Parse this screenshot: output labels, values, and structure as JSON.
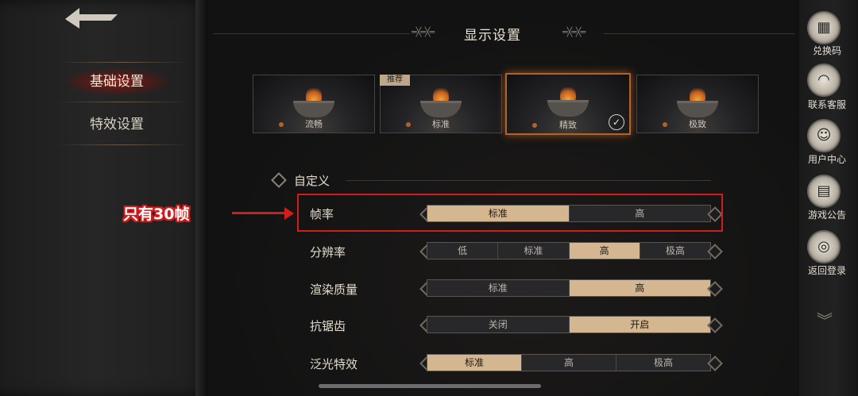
{
  "nav": {
    "items": [
      {
        "label": "基础设置",
        "active": true
      },
      {
        "label": "特效设置",
        "active": false
      }
    ]
  },
  "header": {
    "title": "显示设置"
  },
  "quality_presets": [
    {
      "label": "流畅",
      "selected": false
    },
    {
      "label": "标准",
      "selected": false,
      "badge": "推荐"
    },
    {
      "label": "精致",
      "selected": true
    },
    {
      "label": "极致",
      "selected": false
    }
  ],
  "custom": {
    "label": "自定义"
  },
  "settings": [
    {
      "label": "帧率",
      "options": [
        "标准",
        "高"
      ],
      "selected": 0
    },
    {
      "label": "分辨率",
      "options": [
        "低",
        "标准",
        "高",
        "极高"
      ],
      "selected": 2
    },
    {
      "label": "渲染质量",
      "options": [
        "标准",
        "高"
      ],
      "selected": 1
    },
    {
      "label": "抗锯齿",
      "options": [
        "关闭",
        "开启"
      ],
      "selected": 1
    },
    {
      "label": "泛光特效",
      "options": [
        "标准",
        "高",
        "极高"
      ],
      "selected": 0
    }
  ],
  "annotation": {
    "text": "只有30帧",
    "color": "#d31c1c"
  },
  "sidebar": {
    "items": [
      {
        "label": "兑换码",
        "icon": "gift-code-icon"
      },
      {
        "label": "联系客服",
        "icon": "headset-icon"
      },
      {
        "label": "用户中心",
        "icon": "user-avatar-icon"
      },
      {
        "label": "游戏公告",
        "icon": "announcement-icon"
      },
      {
        "label": "返回登录",
        "icon": "logout-icon"
      }
    ]
  },
  "colors": {
    "accent": "#d4b690",
    "selection_glow": "#b0642a",
    "nav_active": "#961e14"
  }
}
